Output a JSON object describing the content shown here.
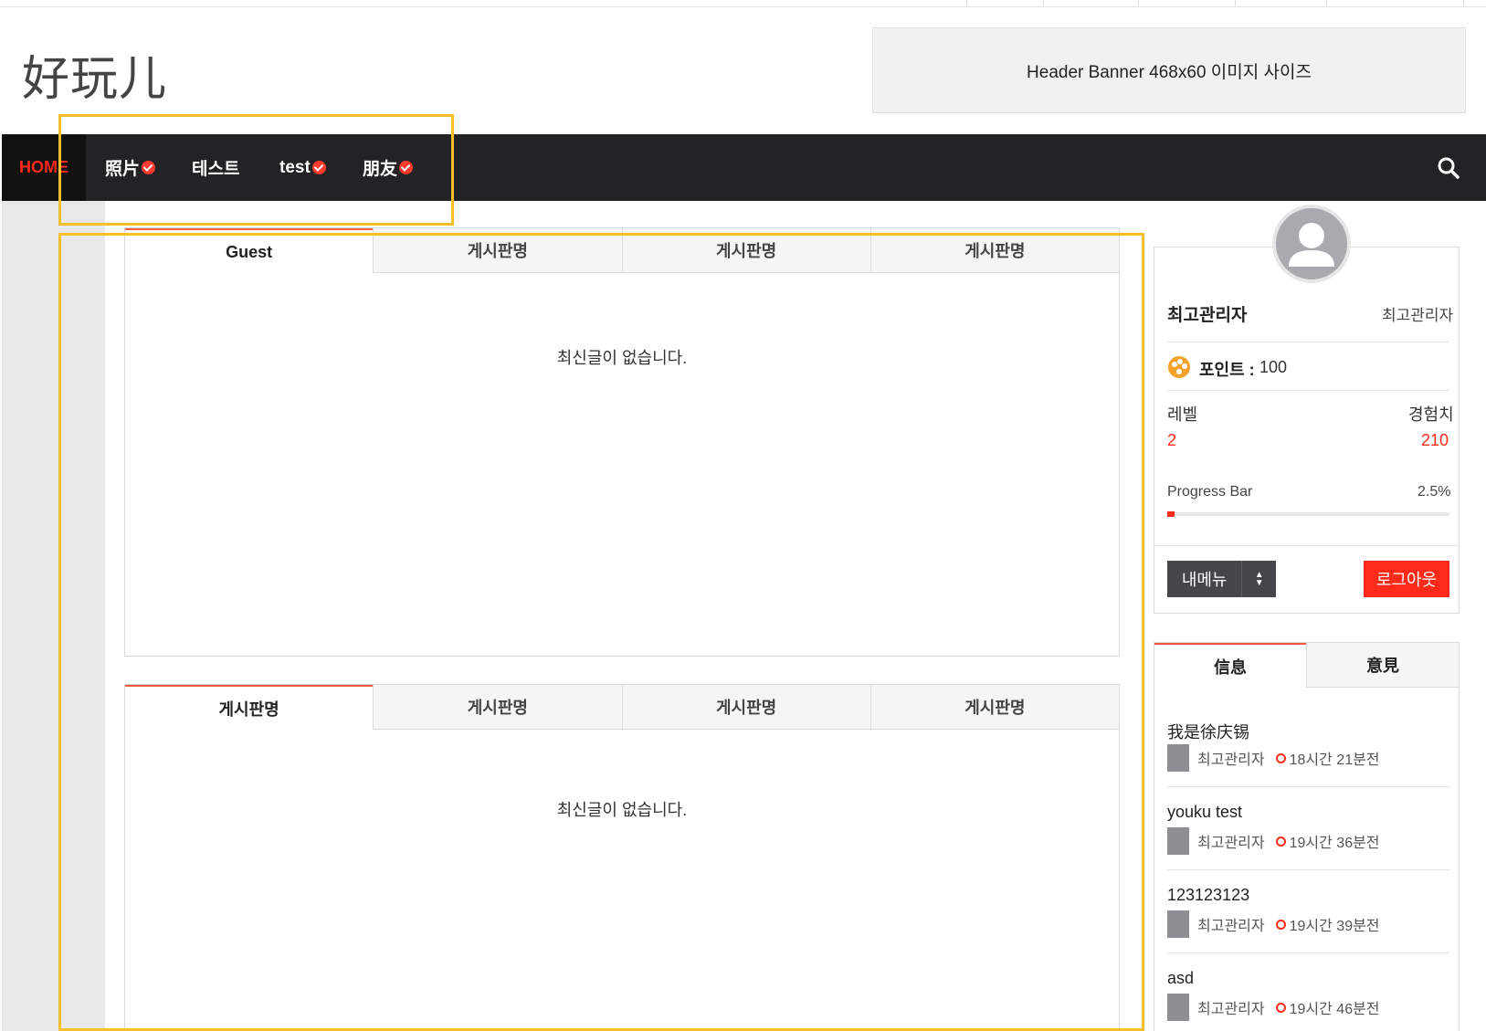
{
  "site": {
    "logo": "好玩儿"
  },
  "header_banner": {
    "text": "Header Banner 468x60 이미지 사이즈"
  },
  "nav": {
    "home": "HOME",
    "items": [
      {
        "label": "照片",
        "has_check": true
      },
      {
        "label": "테스트",
        "has_check": false
      },
      {
        "label": "test",
        "has_check": true
      },
      {
        "label": "朋友",
        "has_check": true
      }
    ],
    "search_icon": "search-icon"
  },
  "panel1": {
    "tabs": [
      "Guest",
      "게시판명",
      "게시판명",
      "게시판명"
    ],
    "empty_text": "최신글이 없습니다."
  },
  "panel2": {
    "tabs": [
      "게시판명",
      "게시판명",
      "게시판명",
      "게시판명"
    ],
    "empty_text": "최신글이 없습니다."
  },
  "profile": {
    "name": "최고관리자",
    "role": "최고관리자",
    "points_label": "포인트 :",
    "points_value": "100",
    "level_label": "레벨",
    "level_value": "2",
    "exp_label": "경험치",
    "exp_value": "210",
    "progress_label": "Progress Bar",
    "progress_text": "2.5%",
    "progress_fraction": 0.025,
    "my_menu": "내메뉴",
    "logout": "로그아웃"
  },
  "info": {
    "tabs": [
      "信息",
      "意見"
    ],
    "posts": [
      {
        "title": "我是徐庆锡",
        "author": "최고관리자",
        "time": "18시간 21분전"
      },
      {
        "title": "youku test",
        "author": "최고관리자",
        "time": "19시간 36분전"
      },
      {
        "title": "123123123",
        "author": "최고관리자",
        "time": "19시간 39분전"
      },
      {
        "title": "asd",
        "author": "최고관리자",
        "time": "19시간 46분전"
      }
    ]
  },
  "colors": {
    "accent": "#ff2a1a",
    "nav_bg": "#232326",
    "highlight": "#f6c02a"
  }
}
